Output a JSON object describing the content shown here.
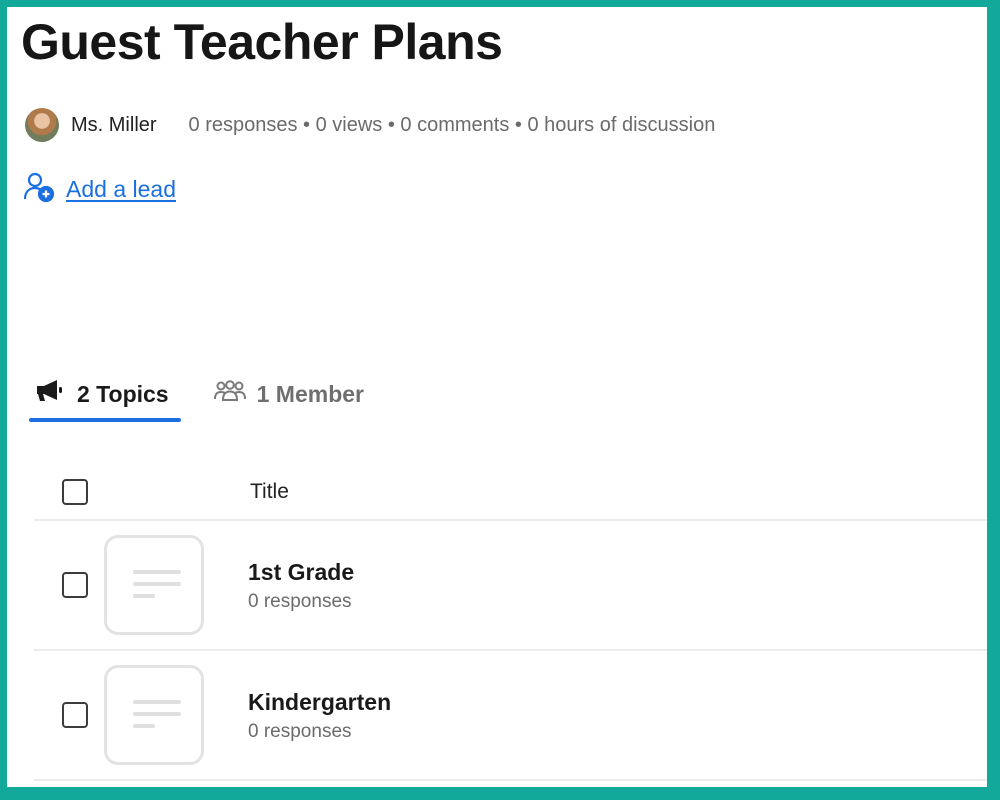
{
  "page": {
    "title": "Guest Teacher Plans"
  },
  "meta": {
    "author": "Ms. Miller",
    "stats": "0 responses • 0 views • 0 comments • 0 hours of discussion"
  },
  "lead": {
    "label": "Add a lead",
    "icon": "add-person-icon"
  },
  "tabs": [
    {
      "label": "2 Topics",
      "icon": "megaphone-icon",
      "active": true
    },
    {
      "label": "1 Member",
      "icon": "group-icon",
      "active": false
    }
  ],
  "table": {
    "column_title": "Title",
    "rows": [
      {
        "title": "1st Grade",
        "subtitle": "0 responses"
      },
      {
        "title": "Kindergarten",
        "subtitle": "0 responses"
      }
    ]
  },
  "colors": {
    "frame": "#12a89a",
    "link": "#1b6fe0",
    "tab_underline": "#1b6fe0"
  }
}
